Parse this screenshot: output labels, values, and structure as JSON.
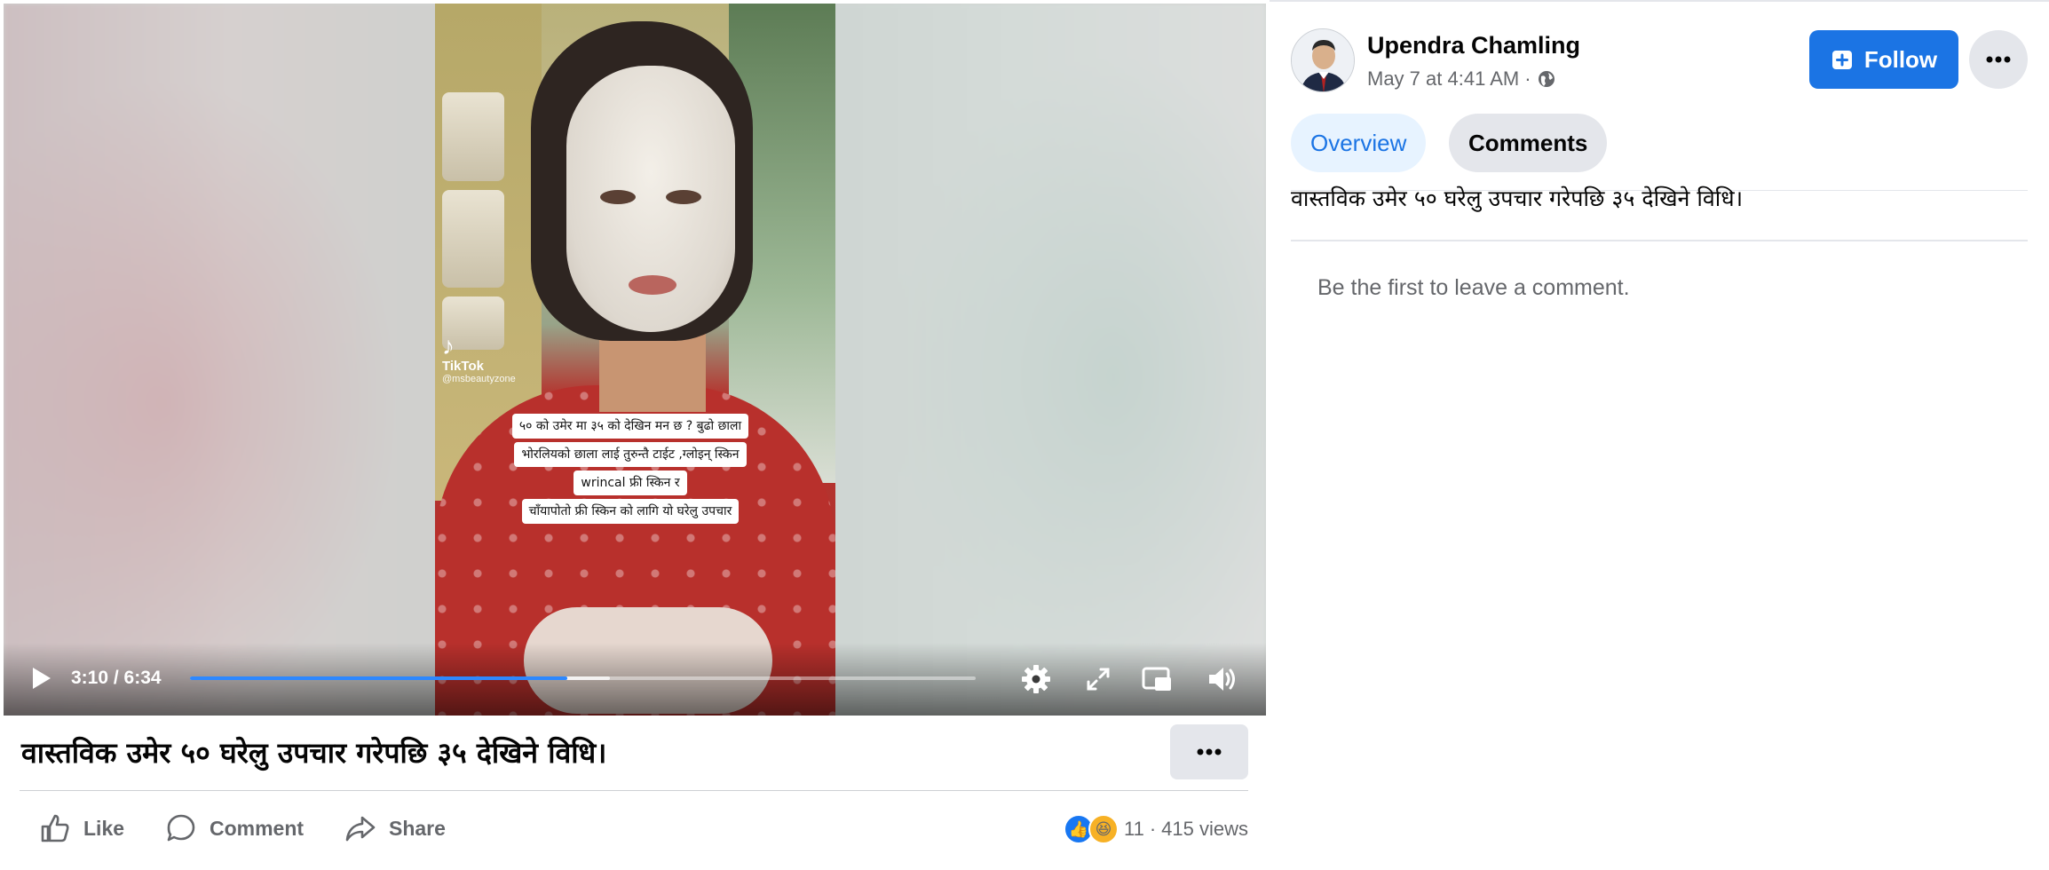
{
  "video": {
    "tiktok_label": "TikTok",
    "tiktok_handle": "@msbeautyzone",
    "caption_lines": [
      "५० को उमेर मा ३५ को देखिन मन छ ? बुढो छाला",
      "भोरलियको छाला  लाई तुरुन्तै टाईट ,ग्लोइन् स्किन",
      "wrincal फ्री  स्किन र",
      "चाँयापोतो फ्री स्किन को लागि यो घरेलु उपचार"
    ],
    "time_display": "3:10 / 6:34",
    "progress_fraction": 0.48,
    "buffered_fraction": 0.535
  },
  "post": {
    "title": "वास्तविक उमेर ५० घरेलु उपचार गरेपछि ३५ देखिने विधि।",
    "actions": {
      "like": "Like",
      "comment": "Comment",
      "share": "Share"
    },
    "reaction_count": "11",
    "separator": "·",
    "views": "415 views"
  },
  "side": {
    "author": "Upendra Chamling",
    "timestamp": "May 7 at 4:41 AM",
    "meta_separator": "·",
    "follow_label": "Follow",
    "tabs": {
      "overview": "Overview",
      "comments": "Comments"
    },
    "post_text": "वास्तविक उमेर ५० घरेलु उपचार गरेपछि ३५ देखिने विधि।",
    "empty_comments": "Be the first to leave a comment."
  },
  "colors": {
    "accent": "#1b74e4",
    "progress": "#2d88ff",
    "muted": "#65676b"
  },
  "icons": [
    "play-icon",
    "settings-icon",
    "fullscreen-icon",
    "miniplayer-icon",
    "volume-icon",
    "more-icon",
    "like-icon",
    "comment-icon",
    "share-icon",
    "globe-icon",
    "follow-icon"
  ]
}
